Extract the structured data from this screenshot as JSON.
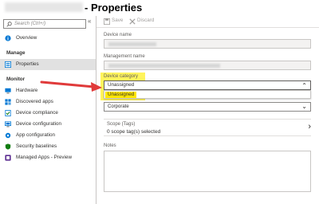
{
  "window": {
    "title": "- Properties"
  },
  "sidebar": {
    "search_placeholder": "Search (Ctrl+/)",
    "overview": "Overview",
    "manage_section": "Manage",
    "properties": "Properties",
    "monitor_section": "Monitor",
    "monitor_items": [
      {
        "label": "Hardware",
        "icon": "hardware-icon"
      },
      {
        "label": "Discovered apps",
        "icon": "apps-icon"
      },
      {
        "label": "Device compliance",
        "icon": "compliance-icon"
      },
      {
        "label": "Device configuration",
        "icon": "configuration-icon"
      },
      {
        "label": "App configuration",
        "icon": "app-config-icon"
      },
      {
        "label": "Security baselines",
        "icon": "security-icon"
      },
      {
        "label": "Managed Apps - Preview",
        "icon": "managed-apps-icon"
      }
    ]
  },
  "toolbar": {
    "save_label": "Save",
    "discard_label": "Discard"
  },
  "form": {
    "device_name_label": "Device name",
    "management_name_label": "Management name",
    "device_category_label": "Device category",
    "device_category_value": "Unassigned",
    "device_category_options": [
      "Unassigned"
    ],
    "ownership_value": "Corporate",
    "scope_label": "Scope (Tags)",
    "scope_value": "0 scope tag(s) selected",
    "notes_label": "Notes"
  },
  "colors": {
    "highlight": "#fff45c",
    "arrow": "#e03a3a",
    "active_nav": "#e1e1e1",
    "accent": "#0078d4"
  }
}
